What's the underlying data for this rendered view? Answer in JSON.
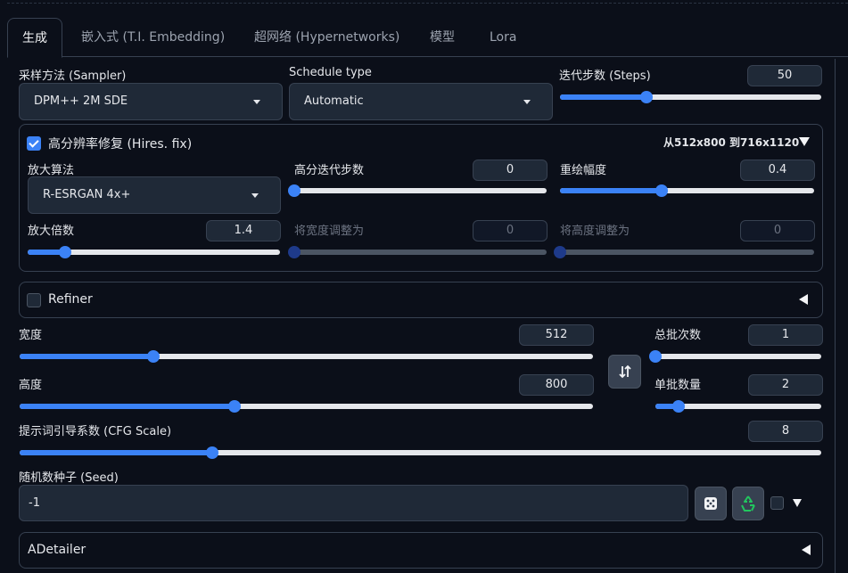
{
  "tabs": [
    {
      "label": "生成",
      "active": true
    },
    {
      "label": "嵌入式 (T.I. Embedding)"
    },
    {
      "label": "超网络 (Hypernetworks)"
    },
    {
      "label": "模型"
    },
    {
      "label": "Lora"
    }
  ],
  "sampler": {
    "label": "采样方法 (Sampler)",
    "value": "DPM++ 2M SDE"
  },
  "schedule": {
    "label": "Schedule type",
    "value": "Automatic"
  },
  "steps": {
    "label": "迭代步数 (Steps)",
    "value": "50",
    "fraction": 0.33
  },
  "hires": {
    "label": "高分辨率修复 (Hires. fix)",
    "checked": true,
    "summary": "从512x800 到716x1120",
    "upscaler": {
      "label": "放大算法",
      "value": "R-ESRGAN 4x+"
    },
    "hires_steps": {
      "label": "高分迭代步数",
      "value": "0",
      "fraction": 0
    },
    "denoise": {
      "label": "重绘幅度",
      "value": "0.4",
      "fraction": 0.4
    },
    "upscale_by": {
      "label": "放大倍数",
      "value": "1.4",
      "fraction": 0.15
    },
    "resize_w": {
      "label": "将宽度调整为",
      "value": "0",
      "fraction": 0
    },
    "resize_h": {
      "label": "将高度调整为",
      "value": "0",
      "fraction": 0
    }
  },
  "refiner": {
    "label": "Refiner",
    "checked": false
  },
  "width": {
    "label": "宽度",
    "value": "512",
    "fraction": 0.233
  },
  "height": {
    "label": "高度",
    "value": "800",
    "fraction": 0.375
  },
  "batch_count": {
    "label": "总批次数",
    "value": "1",
    "fraction": 0
  },
  "batch_size": {
    "label": "单批数量",
    "value": "2",
    "fraction": 0.14
  },
  "cfg": {
    "label": "提示词引导系数 (CFG Scale)",
    "value": "8",
    "fraction": 0.24
  },
  "seed": {
    "label": "随机数种子 (Seed)",
    "value": "-1"
  },
  "adetailer": {
    "label": "ADetailer"
  },
  "icons": {
    "swap": "swap-arrows-icon",
    "dice": "dice-icon",
    "recycle": "recycle-icon"
  },
  "colors": {
    "accent": "#3b82f6",
    "background": "#0b0f19",
    "input": "#1f2937",
    "border": "#374151"
  }
}
